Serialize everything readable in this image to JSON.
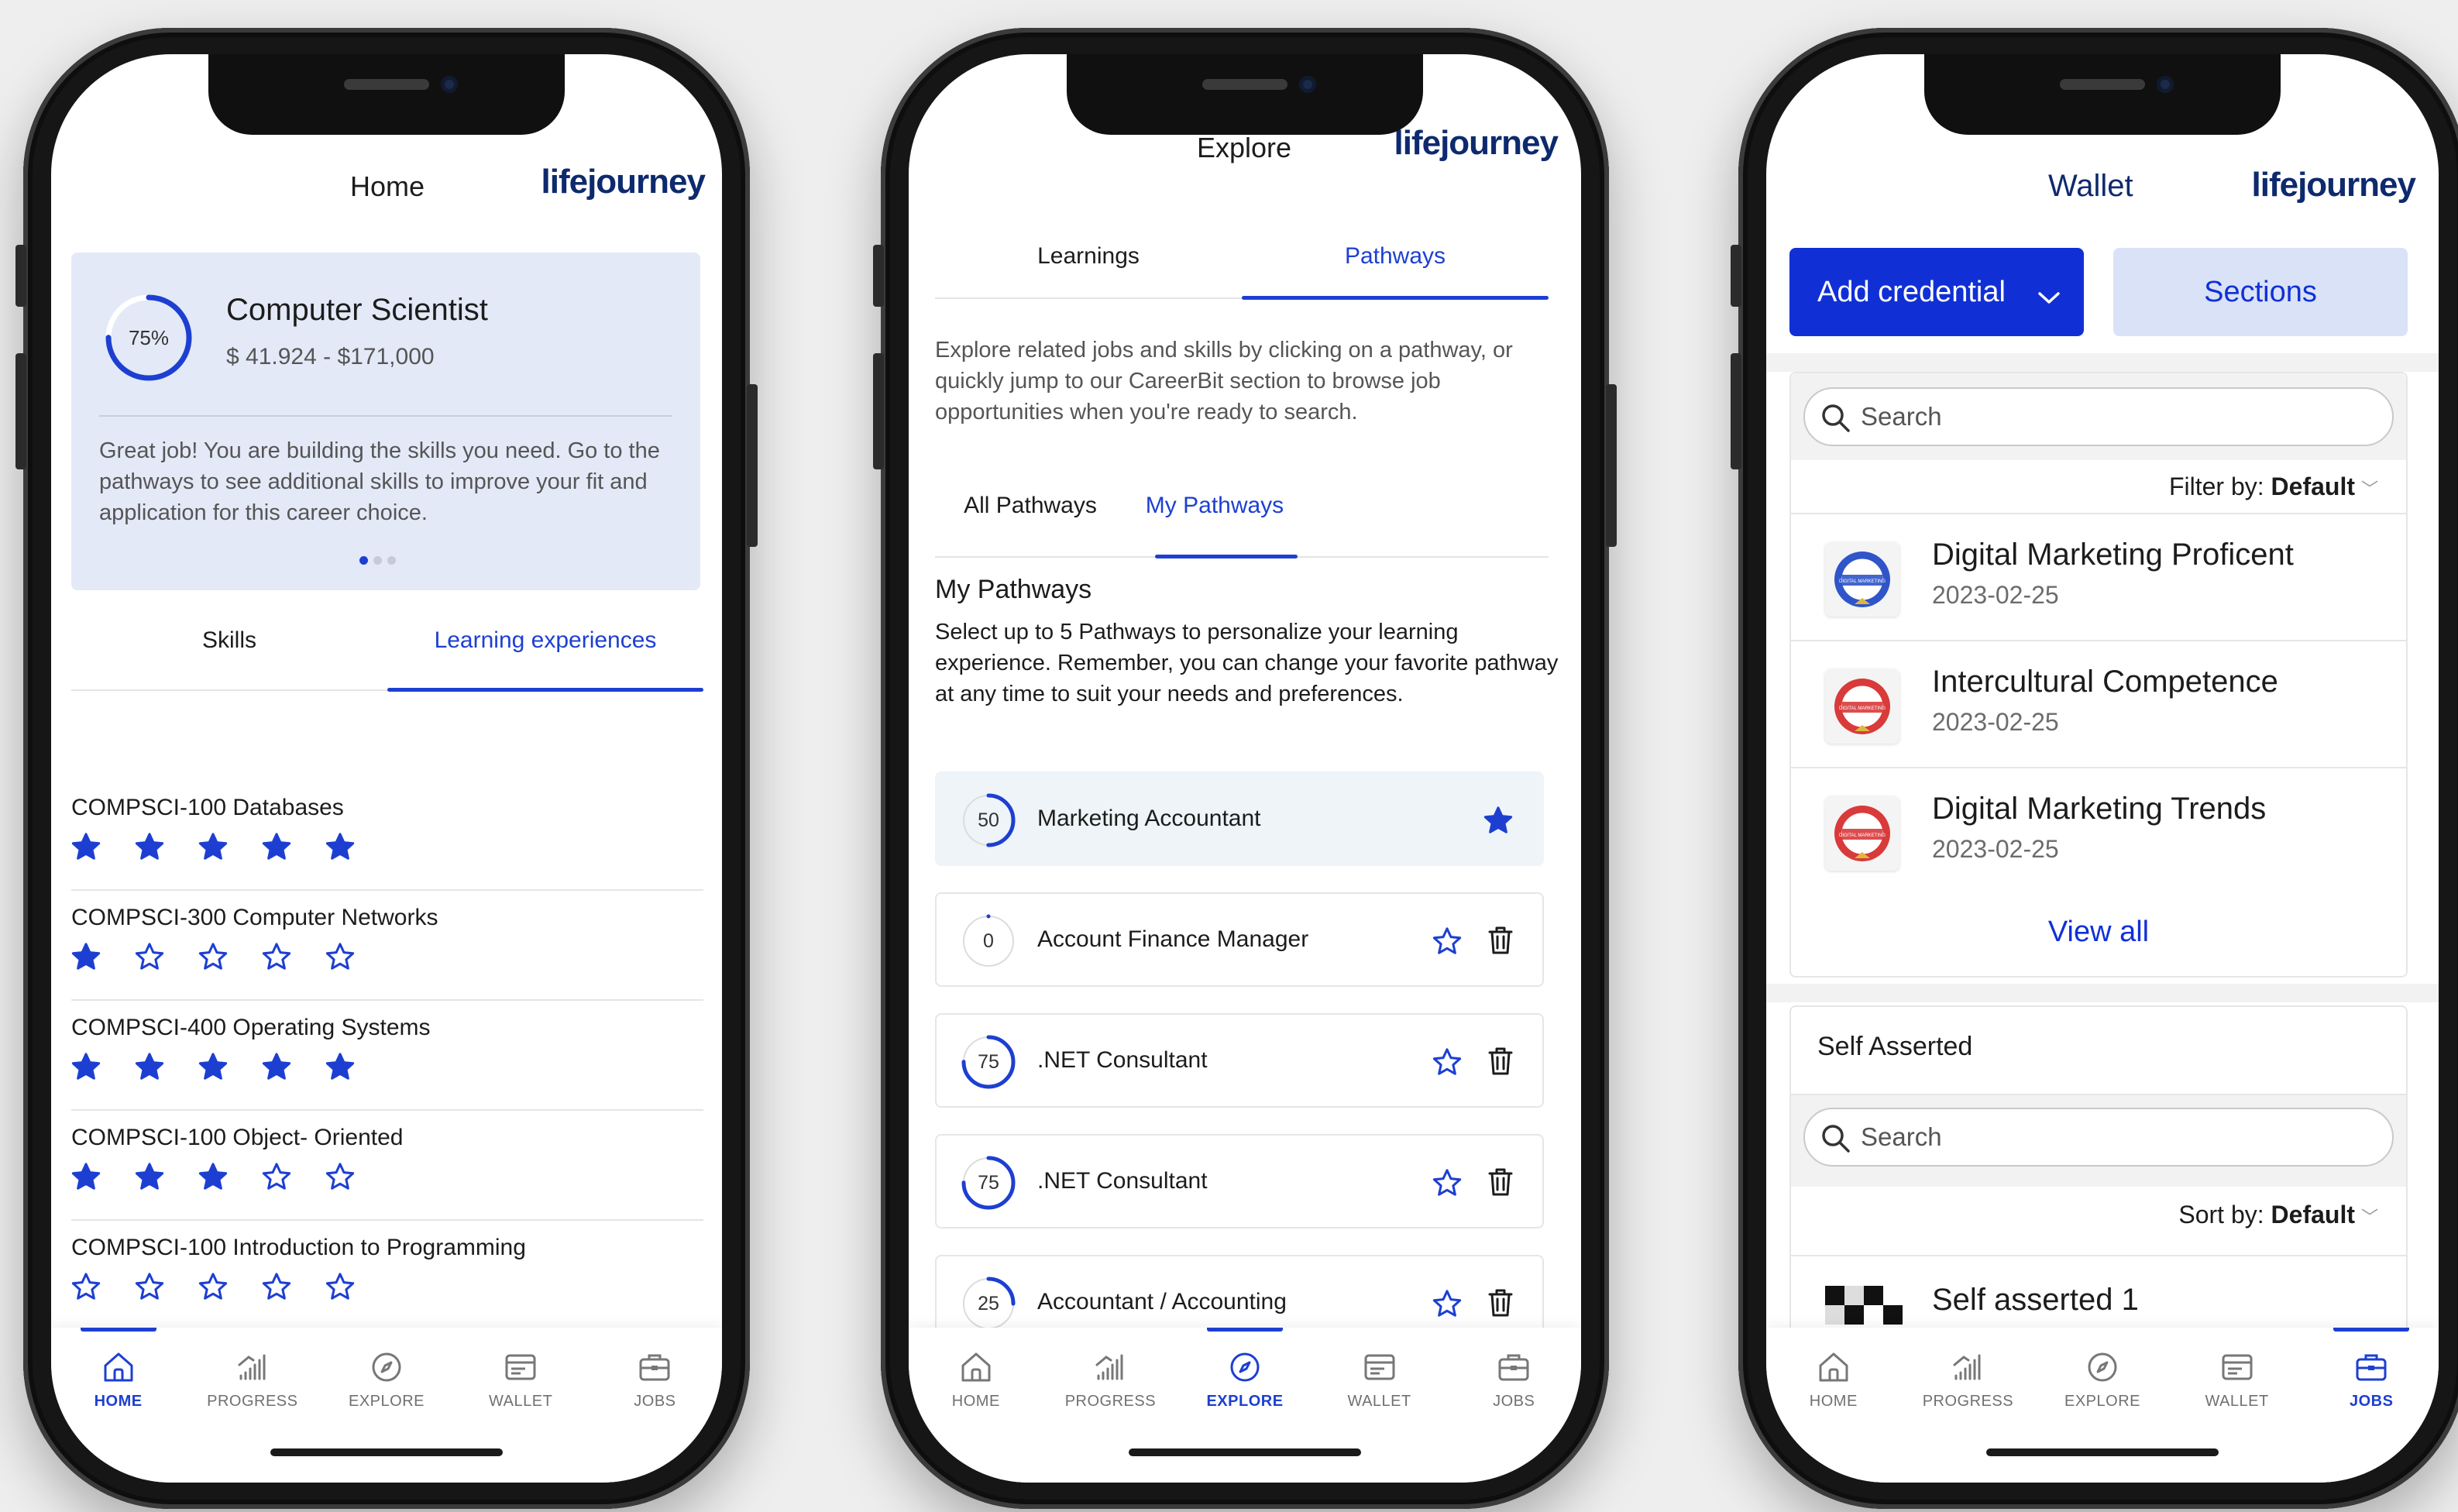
{
  "brand": "lifejourney",
  "tabbar": [
    "HOME",
    "PROGRESS",
    "EXPLORE",
    "WALLET",
    "JOBS"
  ],
  "phone1": {
    "title": "Home",
    "career_card": {
      "percent": "75%",
      "job": "Computer Scientist",
      "salary": "$ 41.924 - $171,000",
      "message": "Great job! You are building the skills you need. Go to the pathways to see additional skills to improve your fit and application for this career choice."
    },
    "tabs": [
      "Skills",
      "Learning experiences"
    ],
    "courses": [
      {
        "name": "COMPSCI-100 Databases",
        "rating": 5
      },
      {
        "name": "COMPSCI-300 Computer Networks",
        "rating": 1
      },
      {
        "name": "COMPSCI-400 Operating Systems",
        "rating": 5
      },
      {
        "name": "COMPSCI-100 Object- Oriented",
        "rating": 3
      },
      {
        "name": "COMPSCI-100 Introduction to Programming",
        "rating": 0
      }
    ],
    "active_tab": "HOME"
  },
  "phone2": {
    "title": "Explore",
    "tabs": [
      "Learnings",
      "Pathways"
    ],
    "intro": "Explore related jobs and skills by clicking on a pathway, or quickly jump to our CareerBit section to browse job opportunities when you're ready to search.",
    "subtabs": [
      "All Pathways",
      "My Pathways"
    ],
    "section_title": "My Pathways",
    "section_desc": "Select up to 5 Pathways to personalize your learning experience. Remember, you can change your favorite pathway at any time to suit your needs and preferences.",
    "pathways": [
      {
        "score": "50",
        "name": "Marketing Accountant",
        "favorite": true
      },
      {
        "score": "0",
        "name": "Account Finance Manager",
        "favorite": false
      },
      {
        "score": "75",
        "name": ".NET Consultant",
        "favorite": false
      },
      {
        "score": "75",
        "name": ".NET Consultant",
        "favorite": false
      },
      {
        "score": "25",
        "name": "Accountant / Accounting",
        "favorite": false
      }
    ],
    "active_tab": "EXPLORE"
  },
  "phone3": {
    "title": "Wallet",
    "add_credential": "Add credential",
    "sections": "Sections",
    "search_placeholder": "Search",
    "filter_label": "Filter by:",
    "filter_value": "Default",
    "credentials": [
      {
        "name": "Digital Marketing Proficent",
        "date": "2023-02-25",
        "color": "#2f55c9",
        "badge_text": "DIGITAL MARKETING"
      },
      {
        "name": "Intercultural Competence",
        "date": "2023-02-25",
        "color": "#d93a3a",
        "badge_text": "DIGITAL MARKETING"
      },
      {
        "name": "Digital Marketing Trends",
        "date": "2023-02-25",
        "color": "#d93a3a",
        "badge_text": "DIGITAL MARKETING"
      }
    ],
    "view_all": "View all",
    "self_asserted_title": "Self Asserted",
    "sort_label": "Sort by:",
    "sort_value": "Default",
    "self_items": [
      "Self asserted 1"
    ],
    "active_tab": "JOBS"
  },
  "colors": {
    "accent": "#1d3fd1",
    "brand": "#0e2a6e",
    "card_bg": "#e3e9f7"
  }
}
